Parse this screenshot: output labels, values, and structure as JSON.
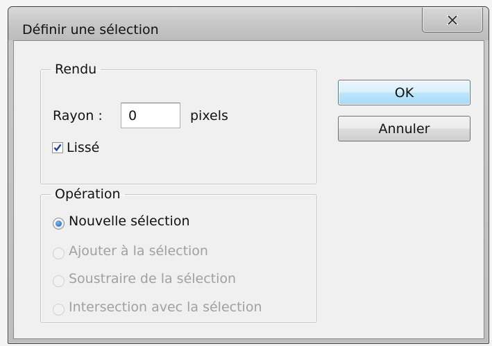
{
  "window": {
    "title": "Définir une sélection",
    "close_glyph": "✕"
  },
  "render_group": {
    "legend": "Rendu",
    "radius_label": "Rayon :",
    "radius_value": "0",
    "radius_unit": "pixels",
    "smooth": {
      "label": "Lissé",
      "checked": true
    }
  },
  "operation_group": {
    "legend": "Opération",
    "options": [
      {
        "label": "Nouvelle sélection",
        "selected": true,
        "enabled": true
      },
      {
        "label": "Ajouter à la sélection",
        "selected": false,
        "enabled": false
      },
      {
        "label": "Soustraire de la sélection",
        "selected": false,
        "enabled": false
      },
      {
        "label": "Intersection avec la sélection",
        "selected": false,
        "enabled": false
      }
    ]
  },
  "buttons": {
    "ok": "OK",
    "cancel": "Annuler"
  },
  "colors": {
    "accent": "#3c7fb1",
    "disabled_text": "#a0a0a0",
    "checkmark": "#1f3f8f"
  }
}
